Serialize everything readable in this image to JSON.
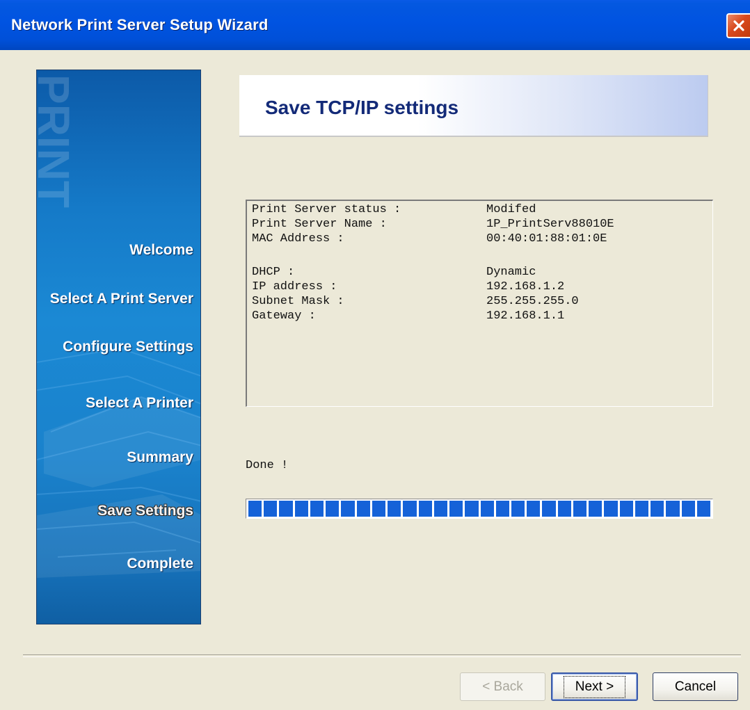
{
  "window": {
    "title": "Network Print Server Setup Wizard"
  },
  "sidebar": {
    "watermark": "PRINT",
    "steps": [
      {
        "label": "Welcome",
        "active": false
      },
      {
        "label": "Select A Print Server",
        "active": false
      },
      {
        "label": "Configure Settings",
        "active": false
      },
      {
        "label": "Select  A  Printer",
        "active": false
      },
      {
        "label": "Summary",
        "active": false
      },
      {
        "label": "Save Settings",
        "active": true
      },
      {
        "label": "Complete",
        "active": false
      }
    ]
  },
  "header": {
    "title": "Save TCP/IP settings"
  },
  "info": {
    "rows": [
      {
        "label": "Print Server status :",
        "value": "Modifed"
      },
      {
        "label": "Print Server Name :",
        "value": "1P_PrintServ88010E"
      },
      {
        "label": "MAC Address :",
        "value": "00:40:01:88:01:0E"
      },
      {
        "label": "DHCP :",
        "value": "Dynamic"
      },
      {
        "label": "IP address :",
        "value": "192.168.1.2"
      },
      {
        "label": "Subnet Mask :",
        "value": "255.255.255.0"
      },
      {
        "label": "Gateway :",
        "value": "192.168.1.1"
      }
    ]
  },
  "status": {
    "text": "Done !",
    "progress_fraction": 1.0
  },
  "buttons": {
    "back": "< Back",
    "next": "Next >",
    "cancel": "Cancel"
  },
  "colors": {
    "titlebar": "#0053e1",
    "sidebar": "#1b89d4",
    "progress": "#1562d8",
    "header_title": "#132a78"
  }
}
